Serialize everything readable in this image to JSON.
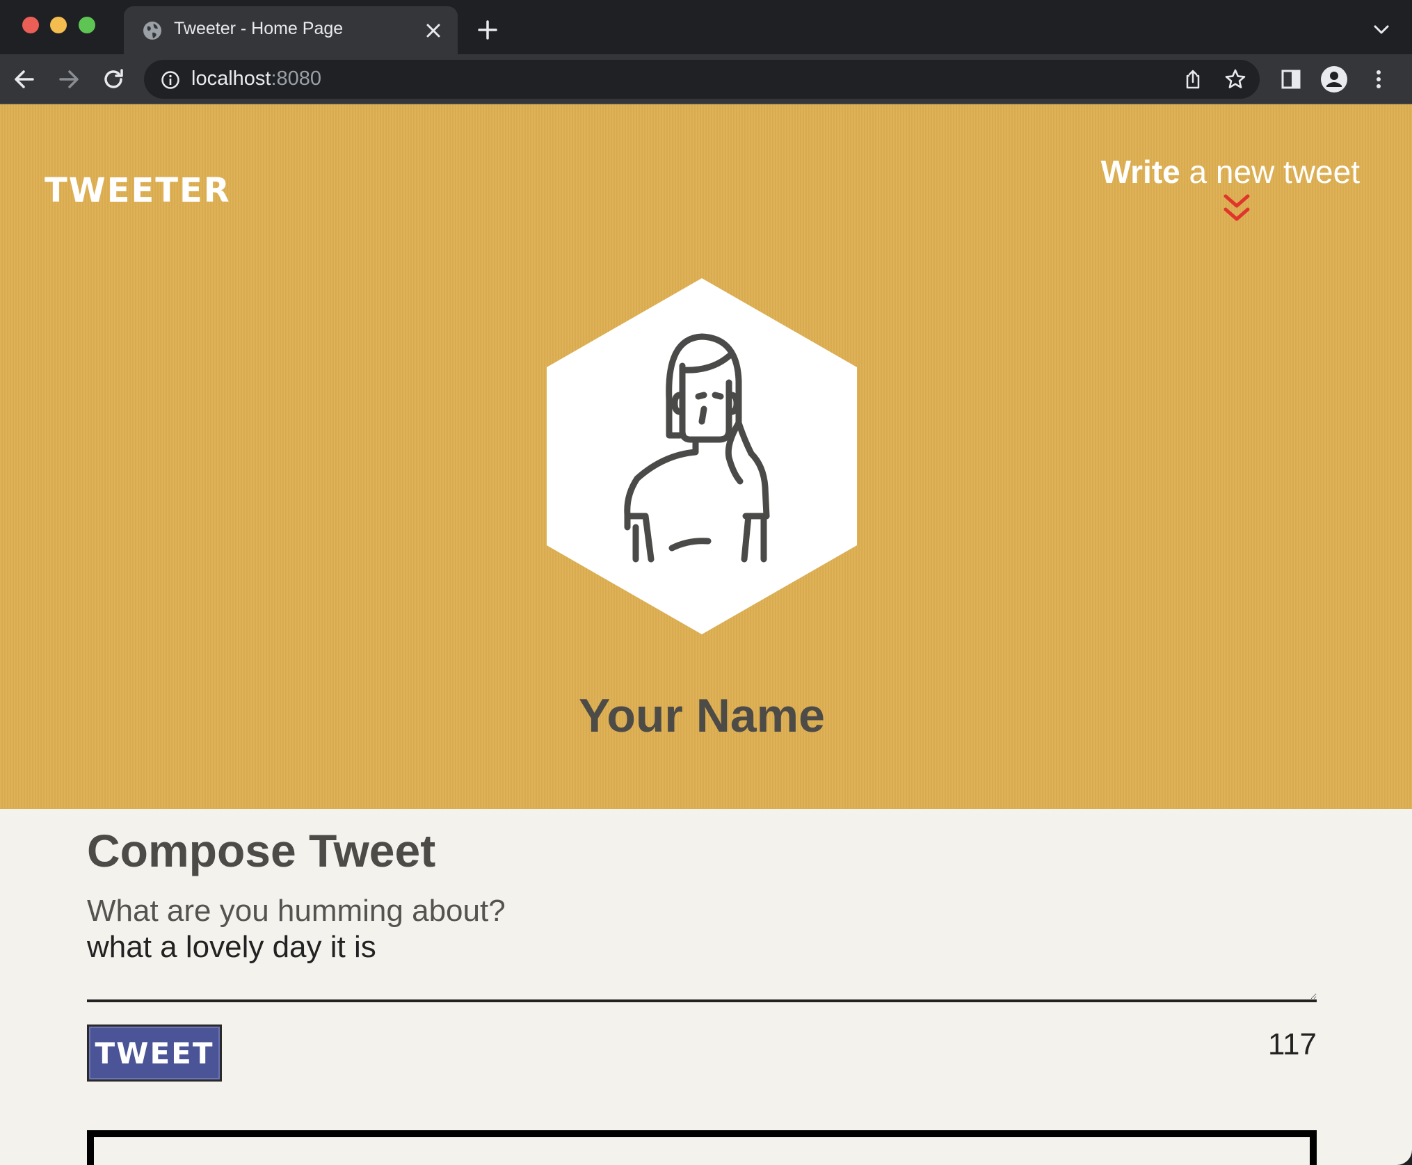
{
  "browser": {
    "tab_title": "Tweeter - Home Page",
    "url_host": "localhost",
    "url_port": ":8080"
  },
  "nav": {
    "brand": "TWEETER",
    "write_strong": "Write",
    "write_rest": " a new tweet"
  },
  "profile": {
    "display_name": "Your Name"
  },
  "compose": {
    "title": "Compose Tweet",
    "label": "What are you humming about?",
    "text_value": "what a lovely day it is",
    "button_label": "TWEET",
    "counter": "117"
  },
  "colors": {
    "hero_bg": "#deaf52",
    "page_bg": "#f4f2ed",
    "button_bg": "#4a5496",
    "arrow_red": "#e0352b",
    "heading_text": "#4d4b47"
  },
  "icons": {
    "tab": "globe-icon",
    "close": "close-icon",
    "new_tab": "plus-icon",
    "back": "arrow-left-icon",
    "forward": "arrow-right-icon",
    "reload": "reload-icon",
    "site_info": "info-icon",
    "share": "share-icon",
    "bookmark": "star-icon",
    "side_panel": "side-panel-icon",
    "profile": "profile-icon",
    "menu": "kebab-menu-icon",
    "write_arrow": "double-chevron-down-icon",
    "avatar": "woman-avatar-icon"
  }
}
